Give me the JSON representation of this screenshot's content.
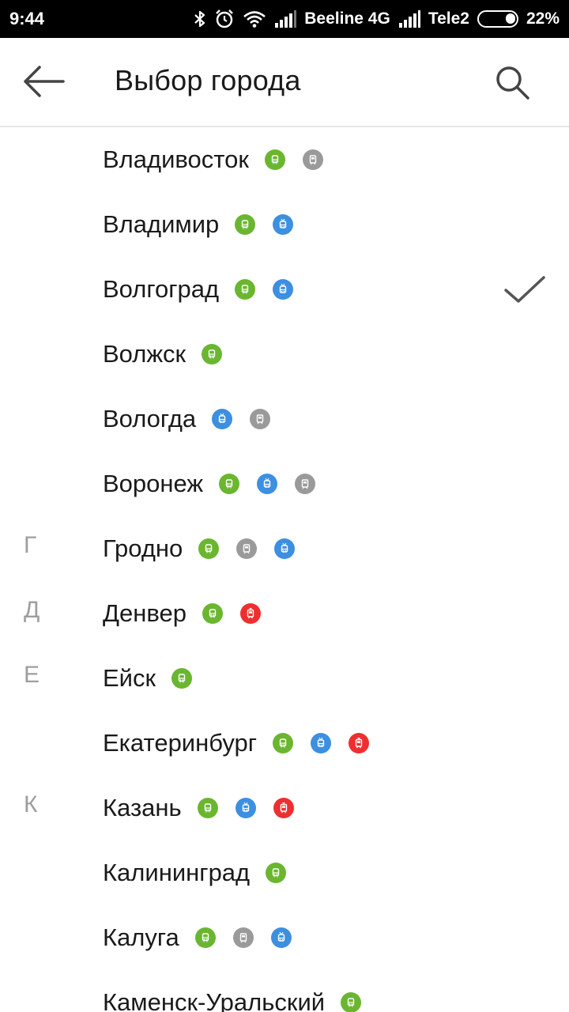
{
  "status_bar": {
    "time": "9:44",
    "carrier1": "Beeline 4G",
    "carrier2": "Tele2",
    "battery": "22%",
    "icons": [
      "bluetooth-icon",
      "alarm-icon",
      "wifi-icon",
      "signal-icon",
      "signal-icon",
      "battery-icon"
    ]
  },
  "header": {
    "title": "Выбор города",
    "back_icon": "arrow-left-icon",
    "search_icon": "search-icon"
  },
  "colors": {
    "bus": "#6ab630",
    "trolleybus": "#3d8fe0",
    "suburban": "#9a9a9a",
    "tram": "#ee2f2f",
    "letter": "#9e9e9e"
  },
  "cities": [
    {
      "letter": "",
      "name": "Владивосток",
      "badges": [
        "bus",
        "suburban"
      ],
      "selected": false
    },
    {
      "letter": "",
      "name": "Владимир",
      "badges": [
        "bus",
        "trolleybus"
      ],
      "selected": false
    },
    {
      "letter": "",
      "name": "Волгоград",
      "badges": [
        "bus",
        "trolleybus"
      ],
      "selected": true
    },
    {
      "letter": "",
      "name": "Волжск",
      "badges": [
        "bus"
      ],
      "selected": false
    },
    {
      "letter": "",
      "name": "Вологда",
      "badges": [
        "trolleybus",
        "suburban"
      ],
      "selected": false
    },
    {
      "letter": "",
      "name": "Воронеж",
      "badges": [
        "bus",
        "trolleybus",
        "suburban"
      ],
      "selected": false
    },
    {
      "letter": "Г",
      "name": "Гродно",
      "badges": [
        "bus",
        "suburban",
        "trolleybus"
      ],
      "selected": false
    },
    {
      "letter": "Д",
      "name": "Денвер",
      "badges": [
        "bus",
        "tram"
      ],
      "selected": false
    },
    {
      "letter": "Е",
      "name": "Ейск",
      "badges": [
        "bus"
      ],
      "selected": false
    },
    {
      "letter": "",
      "name": "Екатеринбург",
      "badges": [
        "bus",
        "trolleybus",
        "tram"
      ],
      "selected": false
    },
    {
      "letter": "К",
      "name": "Казань",
      "badges": [
        "bus",
        "trolleybus",
        "tram"
      ],
      "selected": false
    },
    {
      "letter": "",
      "name": "Калининград",
      "badges": [
        "bus"
      ],
      "selected": false
    },
    {
      "letter": "",
      "name": "Калуга",
      "badges": [
        "bus",
        "suburban",
        "trolleybus"
      ],
      "selected": false
    },
    {
      "letter": "",
      "name": "Каменск-Уральский",
      "badges": [
        "bus"
      ],
      "selected": false
    }
  ]
}
